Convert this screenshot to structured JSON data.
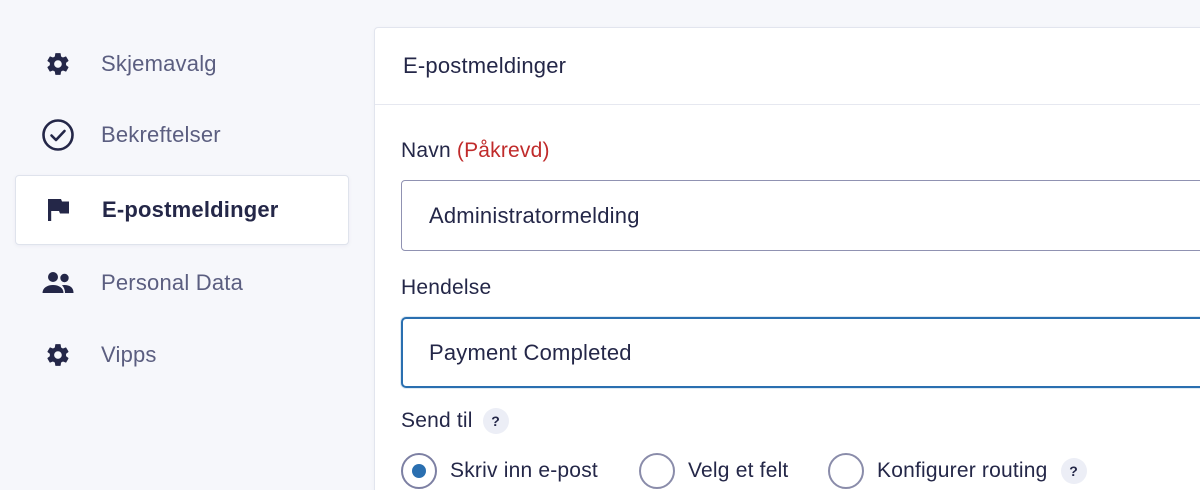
{
  "sidebar": {
    "items": [
      {
        "label": "Skjemavalg",
        "icon": "gear-icon",
        "active": false
      },
      {
        "label": "Bekreftelser",
        "icon": "check-circle-icon",
        "active": false
      },
      {
        "label": "E-postmeldinger",
        "icon": "flag-icon",
        "active": true
      },
      {
        "label": "Personal Data",
        "icon": "users-icon",
        "active": false
      },
      {
        "label": "Vipps",
        "icon": "gear-icon",
        "active": false
      }
    ]
  },
  "panel": {
    "title": "E-postmeldinger",
    "name_field": {
      "label": "Navn",
      "required_text": "(Påkrevd)",
      "value": "Administratormelding"
    },
    "event_field": {
      "label": "Hendelse",
      "selected": "Payment Completed"
    },
    "send_to": {
      "label": "Send til",
      "help": "?",
      "options": [
        {
          "label": "Skriv inn e-post",
          "checked": true
        },
        {
          "label": "Velg et felt",
          "checked": false
        },
        {
          "label": "Konfigurer routing",
          "checked": false
        }
      ],
      "routing_help": "?"
    }
  },
  "colors": {
    "accent": "#2a6fb0",
    "required": "#c02b2b",
    "text": "#242748",
    "muted_text": "#5b5e80",
    "background": "#f6f7fb"
  }
}
